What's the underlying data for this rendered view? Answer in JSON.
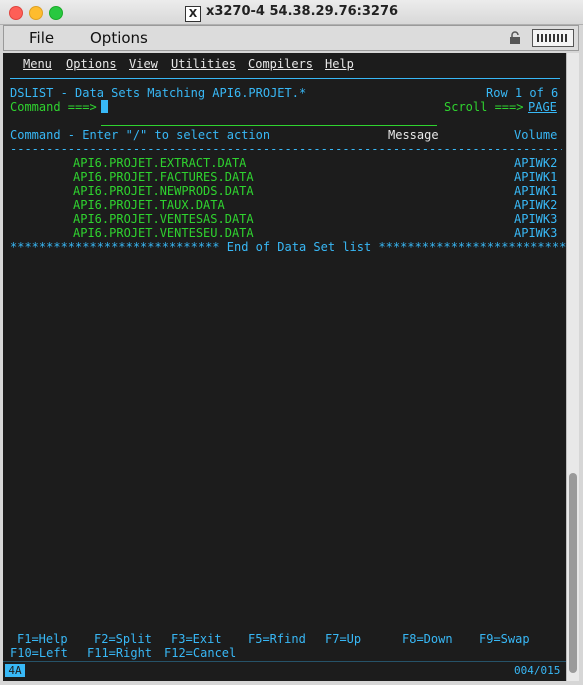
{
  "window": {
    "title": "x3270-4 54.38.29.76:3276"
  },
  "app_menu": {
    "file": "File",
    "options": "Options"
  },
  "ispf_menu": {
    "menu": "Menu",
    "options": "Options",
    "view": "View",
    "utilities": "Utilities",
    "compilers": "Compilers",
    "help": "Help"
  },
  "panel": {
    "title": "DSLIST - Data Sets Matching API6.PROJET.*",
    "row_info": "Row 1 of 6",
    "command_label": "Command ===>",
    "command_value": "",
    "scroll_label": "Scroll ===>",
    "scroll_value": "PAGE",
    "col_command": "Command - Enter \"/\" to select action",
    "col_message": "Message",
    "col_volume": "Volume",
    "divider": "-------------------------------------------------------------------------------",
    "end_marker": "***************************** End of Data Set list ****************************"
  },
  "datasets": [
    {
      "name": "API6.PROJET.EXTRACT.DATA",
      "volume": "APIWK2"
    },
    {
      "name": "API6.PROJET.FACTURES.DATA",
      "volume": "APIWK1"
    },
    {
      "name": "API6.PROJET.NEWPRODS.DATA",
      "volume": "APIWK1"
    },
    {
      "name": "API6.PROJET.TAUX.DATA",
      "volume": "APIWK2"
    },
    {
      "name": "API6.PROJET.VENTESAS.DATA",
      "volume": "APIWK3"
    },
    {
      "name": "API6.PROJET.VENTESEU.DATA",
      "volume": "APIWK3"
    }
  ],
  "pf_keys": {
    "f1": "F1=Help",
    "f2": "F2=Split",
    "f3": "F3=Exit",
    "f5": "F5=Rfind",
    "f7": "F7=Up",
    "f8": "F8=Down",
    "f9": "F9=Swap",
    "f10": "F10=Left",
    "f11": "F11=Right",
    "f12": "F12=Cancel"
  },
  "oia": {
    "mode": "4A",
    "cursor_pos": "004/015"
  },
  "colors": {
    "cyan": "#38b8f6",
    "green": "#2fd32f",
    "background": "#1c1c1c"
  }
}
